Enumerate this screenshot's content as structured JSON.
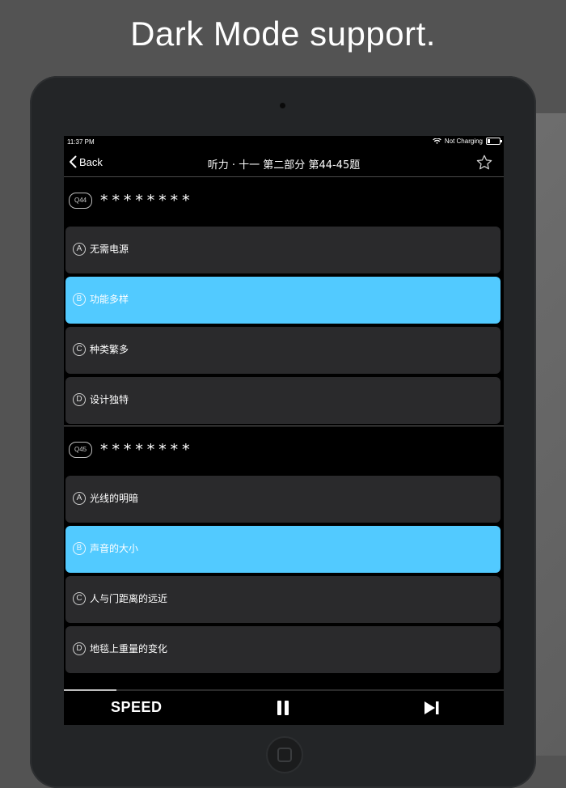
{
  "headline": "Dark Mode support.",
  "status": {
    "time": "11:37 PM",
    "charging": "Not Charging"
  },
  "nav": {
    "back_label": "Back",
    "title": "听力 · 十一 第二部分 第44-45题"
  },
  "questions": [
    {
      "badge": "Q44",
      "text": "********",
      "options": [
        {
          "letter": "A",
          "text": "无需电源",
          "selected": false
        },
        {
          "letter": "B",
          "text": "功能多样",
          "selected": true
        },
        {
          "letter": "C",
          "text": "种类繁多",
          "selected": false
        },
        {
          "letter": "D",
          "text": "设计独特",
          "selected": false
        }
      ]
    },
    {
      "badge": "Q45",
      "text": "********",
      "options": [
        {
          "letter": "A",
          "text": "光线的明暗",
          "selected": false
        },
        {
          "letter": "B",
          "text": "声音的大小",
          "selected": true
        },
        {
          "letter": "C",
          "text": "人与门距离的远近",
          "selected": false
        },
        {
          "letter": "D",
          "text": "地毯上重量的变化",
          "selected": false
        }
      ]
    }
  ],
  "player": {
    "speed_label": "SPEED",
    "progress_fraction": 0.12
  },
  "colors": {
    "selected_option": "#52caff",
    "option_bg": "#2a2a2c",
    "screen_bg": "#000000"
  },
  "icons": {
    "back": "chevron-left-icon",
    "favorite": "star-outline-icon",
    "pause": "pause-icon",
    "next": "skip-next-icon",
    "wifi": "wifi-icon",
    "battery": "battery-icon"
  }
}
